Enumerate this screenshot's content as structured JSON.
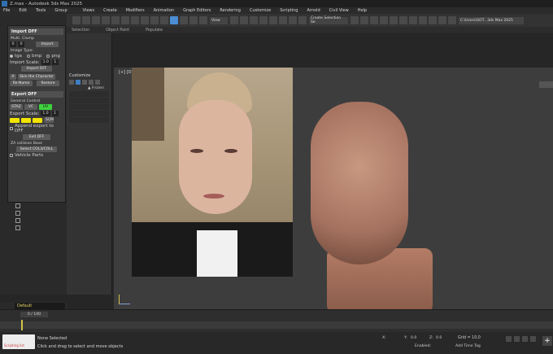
{
  "window": {
    "title": "Z.max - Autodesk 3ds Max 2025"
  },
  "menu": [
    "File",
    "Edit",
    "Tools",
    "Group",
    "Views",
    "Create",
    "Modifiers",
    "Animation",
    "Graph Editors",
    "Rendering",
    "Customize",
    "Scripting",
    "Arnold",
    "Civil View",
    "Help"
  ],
  "toolbar": {
    "view_drop": "View",
    "selection_set": "Create Selection Se",
    "project_path": "C:\\Users\\SOT...3ds Max 2025"
  },
  "ribbon": [
    "Selection",
    "Object Paint",
    "Populate"
  ],
  "import_panel": {
    "header": "Import DFF",
    "multi_clump_label": "Multi. Clump",
    "clump_value": "0",
    "clump_value2": "0",
    "import_button": "Import",
    "image_type_label": "Image Type:",
    "image_types": [
      "tga",
      "bmp",
      "png"
    ],
    "import_scale_label": "Import Scale:",
    "import_scale_value": "1.0",
    "import_scale_value2": "1",
    "import_dff_button": "Import DFF",
    "a_button": "A",
    "skin_button": "Skin the Character",
    "rename_button": "Re-Name",
    "restore_button": "Restore"
  },
  "export_panel": {
    "header": "Export DFF",
    "general_label": "General Control",
    "std_button": "STAZ",
    "vc_button": "VC",
    "green_label": "UV",
    "export_scale_label": "Export Scale:",
    "export_scale_value": "1.0",
    "export_scale_value2": "1",
    "scale_button": "SCM",
    "append_label": "Append export to DFF",
    "export_dff_button": "Exit DFF",
    "collision_label": "ZA collision Base",
    "select_collision_button": "Select COL3/COLL",
    "vehicle_label": "Vehicle Parts"
  },
  "command_panel": {
    "title": "Customize",
    "frozen_label": "▲ Frozen"
  },
  "viewport": {
    "label": "[+] [Or"
  },
  "layer": {
    "name": "Default"
  },
  "timeline": {
    "frame": "0 / 100"
  },
  "status": {
    "script_label": "Scripting list",
    "message1": "None Selected",
    "message2": "Click and drag to select and move objects",
    "x_label": "X:",
    "y_label": "Y:",
    "y_value": "0.0",
    "z_label": "Z:",
    "z_value": "0.0",
    "grid": "Grid = 10,0",
    "enabled": "Enabled:",
    "add_time_tag": "Add Time Tag"
  },
  "colors": {
    "accent": "#4c8ed6",
    "yellow": "#f2e400",
    "green": "#3fd13f"
  }
}
